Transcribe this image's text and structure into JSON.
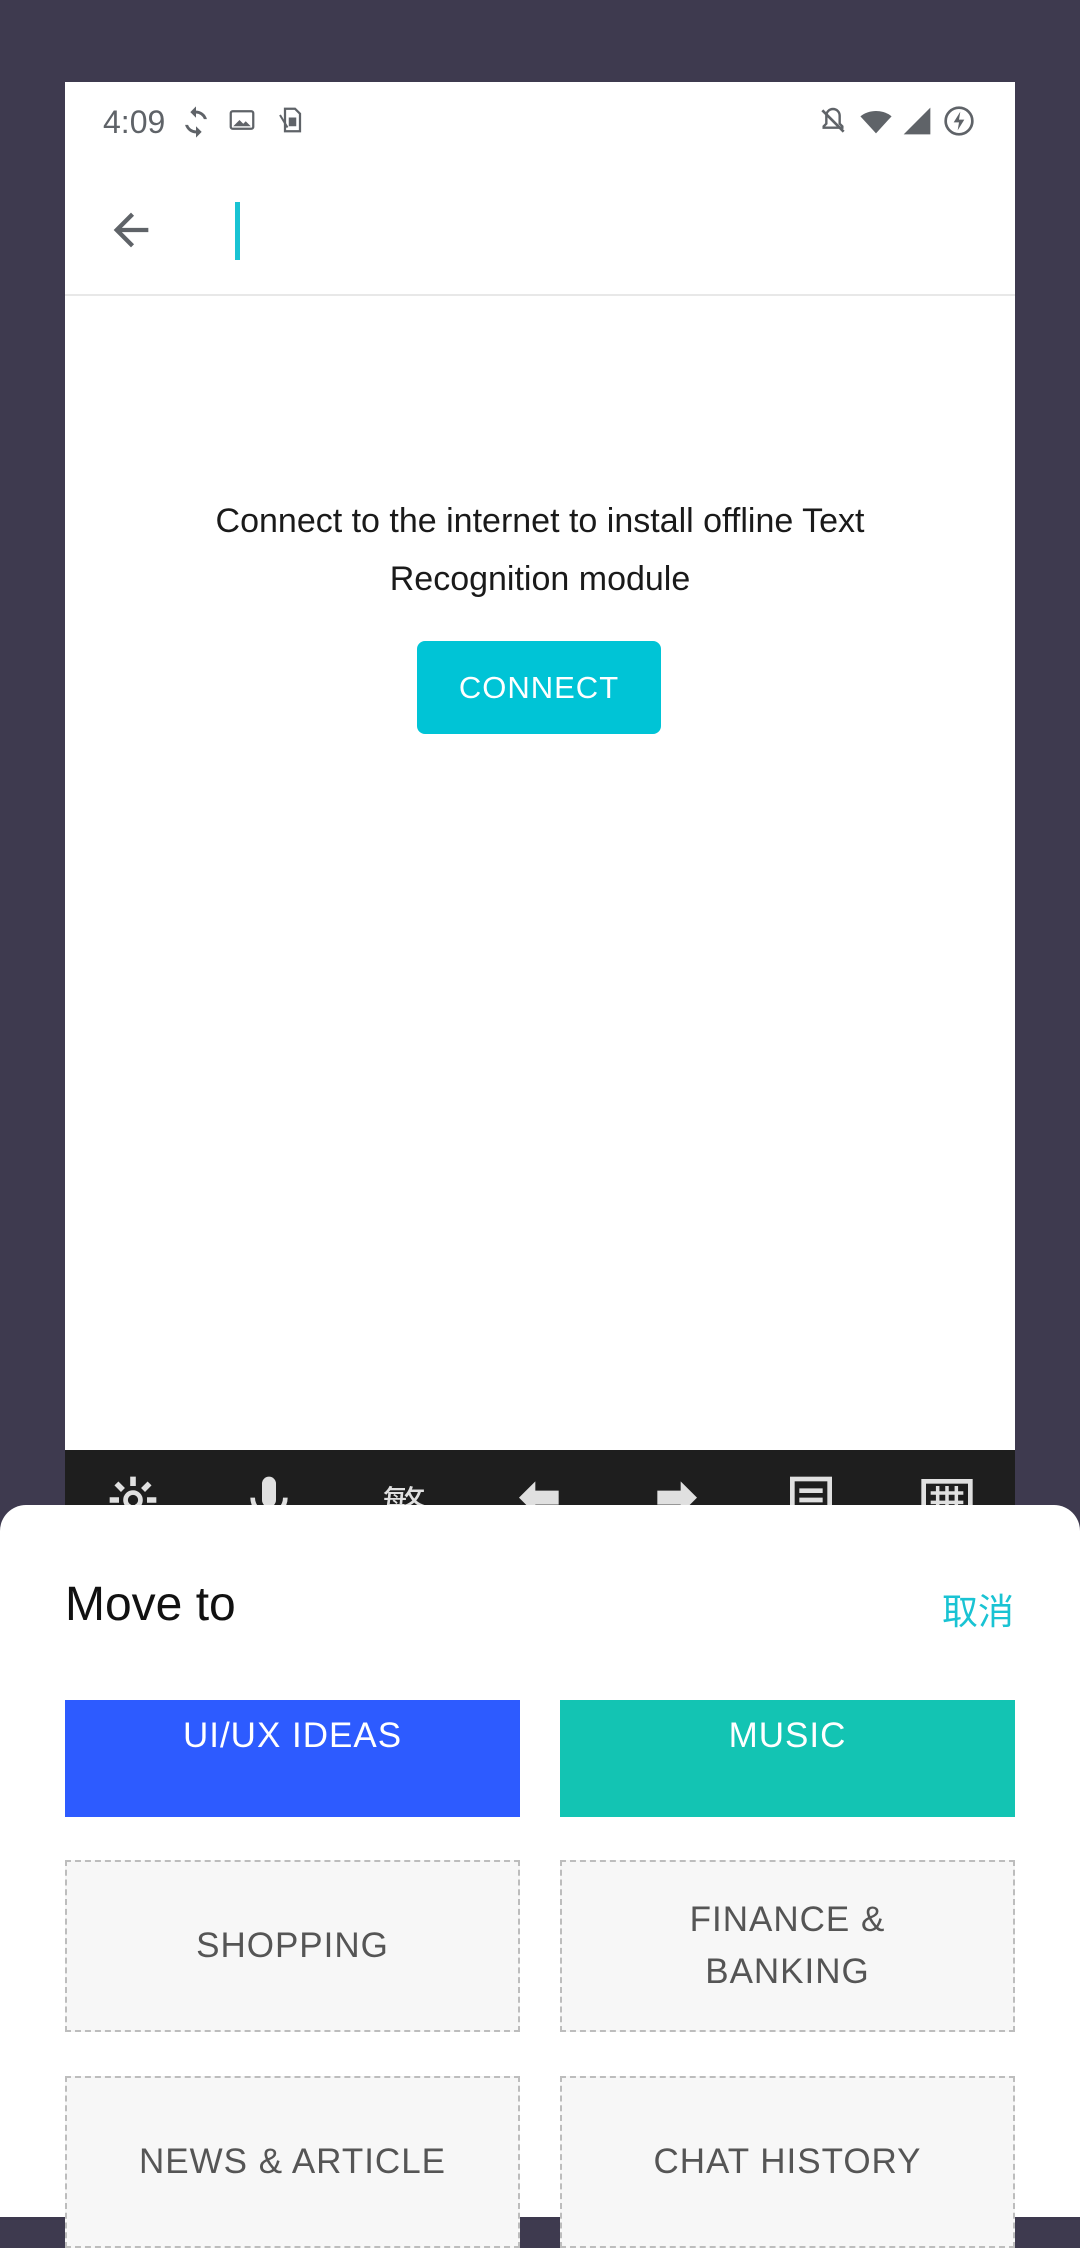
{
  "status_bar": {
    "time": "4:09",
    "left_icons": [
      "sync-icon",
      "image-icon",
      "sim-icon"
    ],
    "right_icons": [
      "mute-icon",
      "wifi-icon",
      "signal-icon",
      "battery-charging-icon"
    ]
  },
  "editor": {
    "title_value": "",
    "message": "Connect to the internet to install offline Text Recognition module",
    "connect_label": "CONNECT"
  },
  "keyboard_toolbar": {
    "items": [
      "settings-icon",
      "microphone-icon",
      "繁",
      "undo-icon",
      "redo-icon",
      "clipboard-icon",
      "keyboard-icon"
    ]
  },
  "sheet": {
    "title": "Move to",
    "cancel_label": "取消",
    "folders": [
      {
        "label": "UI/UX IDEAS",
        "style": "filled",
        "color": "#2d5bff"
      },
      {
        "label": "MUSIC",
        "style": "filled",
        "color": "#13c4b3"
      },
      {
        "label": "SHOPPING",
        "style": "dashed"
      },
      {
        "label": "FINANCE & BANKING",
        "style": "dashed"
      },
      {
        "label": "NEWS & ARTICLE",
        "style": "dashed"
      },
      {
        "label": "CHAT HISTORY",
        "style": "dashed"
      }
    ]
  },
  "colors": {
    "background": "#3e3a4f",
    "accent": "#00c4d6",
    "folder_blue": "#2d5bff",
    "folder_teal": "#13c4b3"
  }
}
